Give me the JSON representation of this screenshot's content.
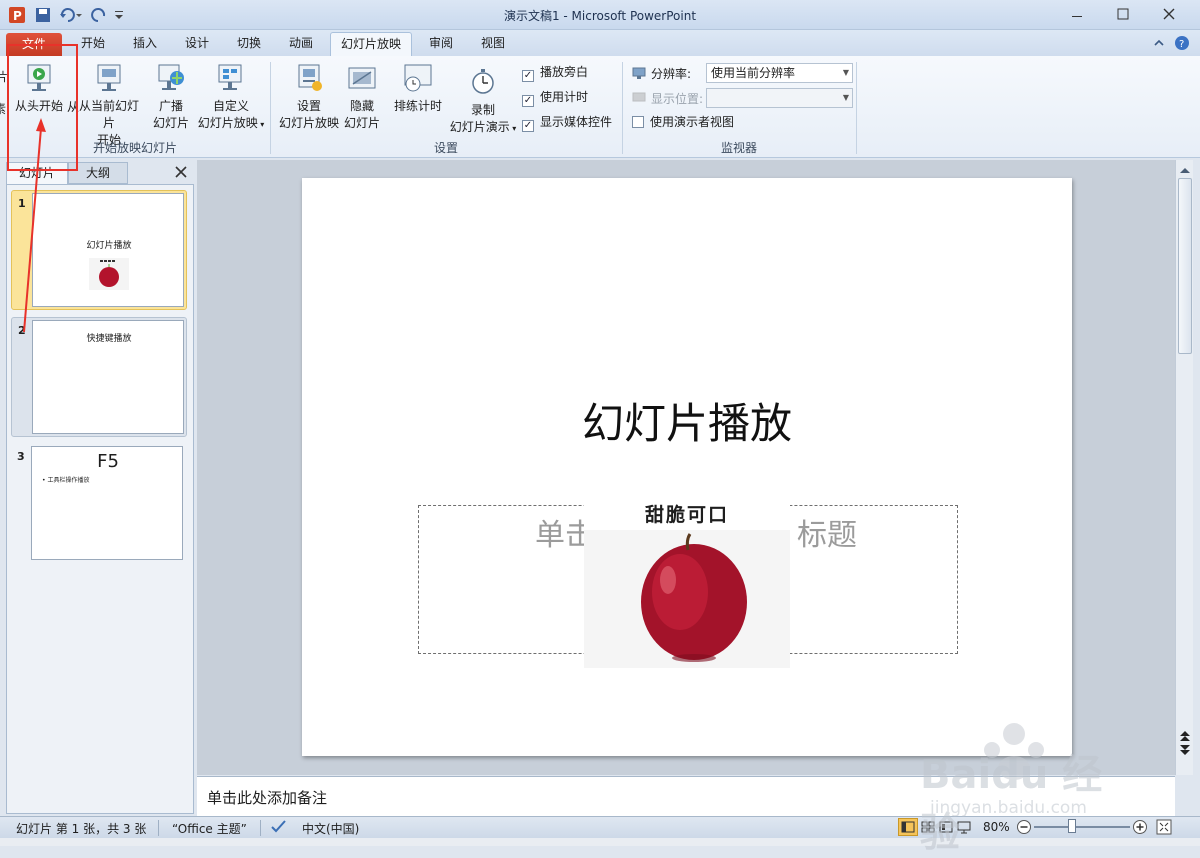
{
  "window": {
    "title": "演示文稿1 - Microsoft PowerPoint"
  },
  "tabs": [
    "文件",
    "开始",
    "插入",
    "设计",
    "切换",
    "动画",
    "幻灯片放映",
    "审阅",
    "视图"
  ],
  "active_tab": "幻灯片放映",
  "ribbon": {
    "start_group": {
      "label": "开始放映幻灯片",
      "from_beginning": "从头开始",
      "from_current_l1": "从当前幻灯片",
      "from_current_l2": "开始",
      "broadcast_l1": "广播",
      "broadcast_l2": "幻灯片",
      "custom_l1": "自定义",
      "custom_l2": "幻灯片放映"
    },
    "setup_group": {
      "label": "设置",
      "setup_l1": "设置",
      "setup_l2": "幻灯片放映",
      "hide_l1": "隐藏",
      "hide_l2": "幻灯片",
      "rehearse": "排练计时",
      "record_l1": "录制",
      "record_l2": "幻灯片演示",
      "play_narrations": "播放旁白",
      "use_timings": "使用计时",
      "show_media_controls": "显示媒体控件"
    },
    "monitors_group": {
      "label": "监视器",
      "resolution_label": "分辨率:",
      "resolution_value": "使用当前分辨率",
      "show_on_label": "显示位置:",
      "show_on_value": "",
      "presenter_view": "使用演示者视图"
    },
    "left_cut_1": "片",
    "left_cut_2": "素",
    "from_current_prefix": "从"
  },
  "left_pane": {
    "tab_slides": "幻灯片",
    "tab_outline": "大纲",
    "thumbnails": [
      {
        "num": "1",
        "title": "幻灯片播放"
      },
      {
        "num": "2",
        "title": "快捷键播放"
      },
      {
        "num": "3",
        "title": "F5",
        "bullet": "工具栏操作播放"
      }
    ]
  },
  "slide": {
    "title": "幻灯片播放",
    "subtitle_placeholder_left": "单击",
    "subtitle_placeholder_right": "标题",
    "image_caption": "甜脆可口"
  },
  "notes": {
    "placeholder": "单击此处添加备注"
  },
  "status": {
    "slide_info": "幻灯片 第 1 张，共 3 张",
    "theme": "“Office 主题”",
    "language": "中文(中国)",
    "zoom": "80%"
  },
  "watermark": {
    "brand": "Baidu 经验",
    "url": "jingyan.baidu.com"
  },
  "colors": {
    "accent_red": "#e8322a",
    "file_tab": "#c43b23",
    "slide_bg": "#ffffff"
  }
}
